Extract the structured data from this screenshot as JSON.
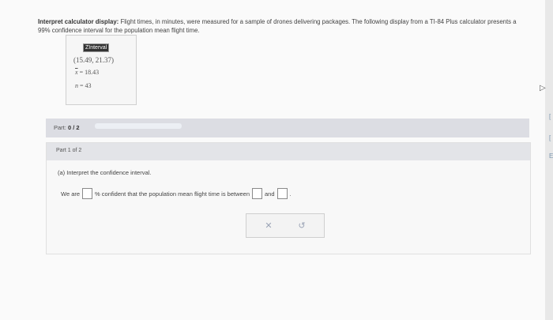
{
  "problem": {
    "label": "Interpret calculator display:",
    "text": "Flight times, in minutes, were measured for a sample of drones delivering packages. The following display from a TI-84 Plus calculator presents a 99% confidence interval for the population mean flight time."
  },
  "calculator": {
    "title": "ZInterval",
    "interval": "(15.49, 21.37)",
    "mean_label": "x",
    "mean_value": "18.43",
    "n_label": "n",
    "n_value": "43"
  },
  "progress": {
    "label": "Part:",
    "current": "0",
    "separator": "/",
    "total": "2",
    "fraction_complete": 0.0,
    "accent_color": "#6b8fd6"
  },
  "part": {
    "header": "Part 1 of 2",
    "question": "(a) Interpret the confidence interval.",
    "answer": {
      "prefix": "We are",
      "middle": "% confident that the population mean flight time is between",
      "connector": "and",
      "suffix": ".",
      "confidence_value": "",
      "lower_value": "",
      "upper_value": ""
    },
    "actions": {
      "clear_icon": "close-icon",
      "undo_icon": "undo-icon"
    }
  }
}
